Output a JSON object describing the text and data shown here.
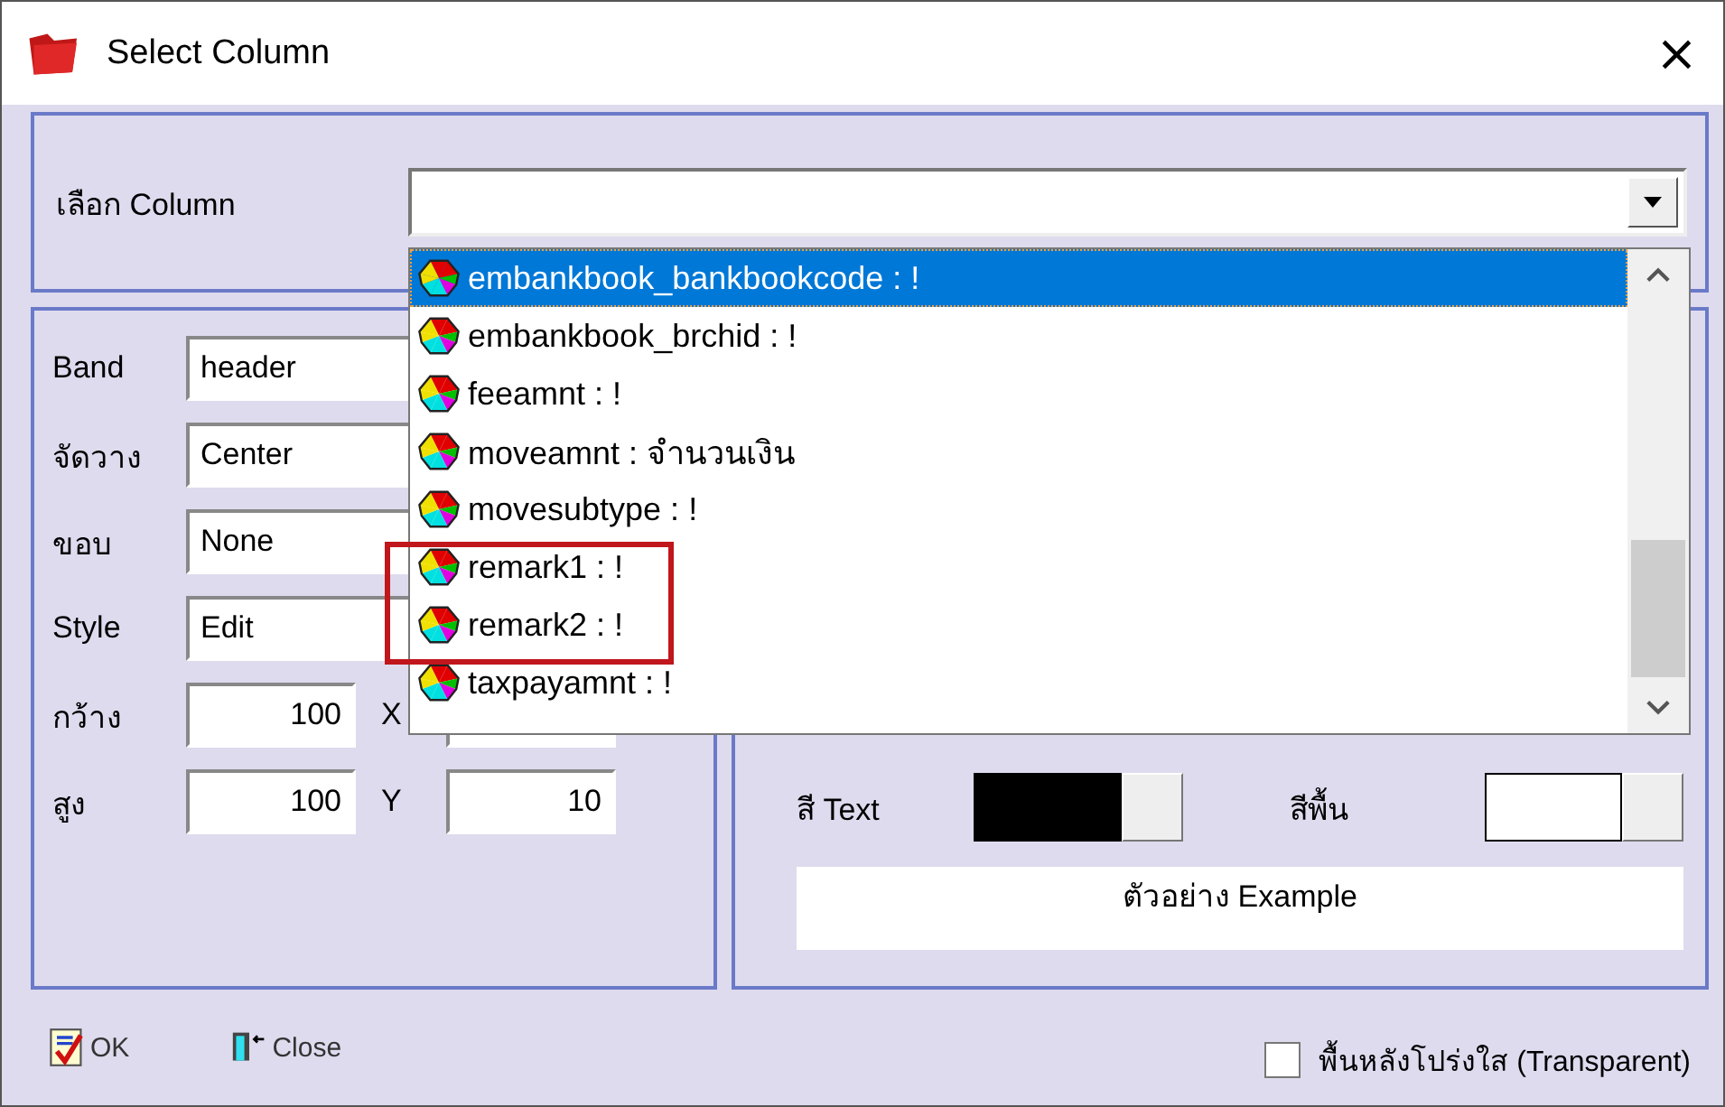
{
  "window": {
    "title": "Select Column",
    "close": "×"
  },
  "column_select": {
    "label": "เลือก Column",
    "expanded": true,
    "items": [
      {
        "label": "embankbook_bankbookcode : !",
        "selected": true,
        "highlighted": false
      },
      {
        "label": "embankbook_brchid : !",
        "selected": false,
        "highlighted": false
      },
      {
        "label": "feeamnt : !",
        "selected": false,
        "highlighted": false
      },
      {
        "label": "moveamnt : จำนวนเงิน",
        "selected": false,
        "highlighted": false
      },
      {
        "label": "movesubtype : !",
        "selected": false,
        "highlighted": false
      },
      {
        "label": "remark1 : !",
        "selected": false,
        "highlighted": true
      },
      {
        "label": "remark2 : !",
        "selected": false,
        "highlighted": true
      },
      {
        "label": "taxpayamnt : !",
        "selected": false,
        "highlighted": false
      }
    ]
  },
  "properties": [
    {
      "label": "Band",
      "value": "header"
    },
    {
      "label": "จัดวาง",
      "value": "Center"
    },
    {
      "label": "ขอบ",
      "value": "None"
    },
    {
      "label": "Style",
      "value": "Edit"
    }
  ],
  "size_rows": [
    {
      "label": "กว้าง",
      "value": "100",
      "label_2": "X"
    },
    {
      "label": "สูง",
      "value": "100",
      "label_2": "Y",
      "value_2": "10"
    }
  ],
  "text_color": {
    "label": "สี Text",
    "color": "#000000"
  },
  "background_color": {
    "label": "สีพื้น",
    "color": "#ffffff"
  },
  "preview": "ตัวอย่าง Example",
  "buttons": [
    {
      "label": "OK",
      "kind": "ok"
    },
    {
      "label": "Close",
      "kind": "close"
    }
  ],
  "transparent": {
    "label": "พื้นหลังโปร่งใส (Transparent)",
    "checked": false
  }
}
